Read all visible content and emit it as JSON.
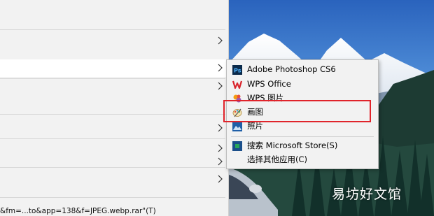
{
  "parent_menu": {
    "status_text": "&fm=...to&app=138&f=JPEG.webp.rar\"(T)"
  },
  "submenu": {
    "items": [
      {
        "label": "Adobe Photoshop CS6",
        "icon": "photoshop-icon"
      },
      {
        "label": "WPS Office",
        "icon": "wps-office-icon"
      },
      {
        "label": "WPS 图片",
        "icon": "wps-picture-icon"
      },
      {
        "label": "画图",
        "icon": "paint-icon"
      },
      {
        "label": "照片",
        "icon": "photos-icon"
      },
      {
        "label": "搜索 Microsoft Store(S)",
        "icon": "store-icon"
      },
      {
        "label": "选择其他应用(C)",
        "icon": ""
      }
    ]
  },
  "watermark": "易坊好文馆",
  "colors": {
    "highlight_box": "#e0242b",
    "menu_bg": "#f2f2f2",
    "sky": "#2f6fc4"
  }
}
